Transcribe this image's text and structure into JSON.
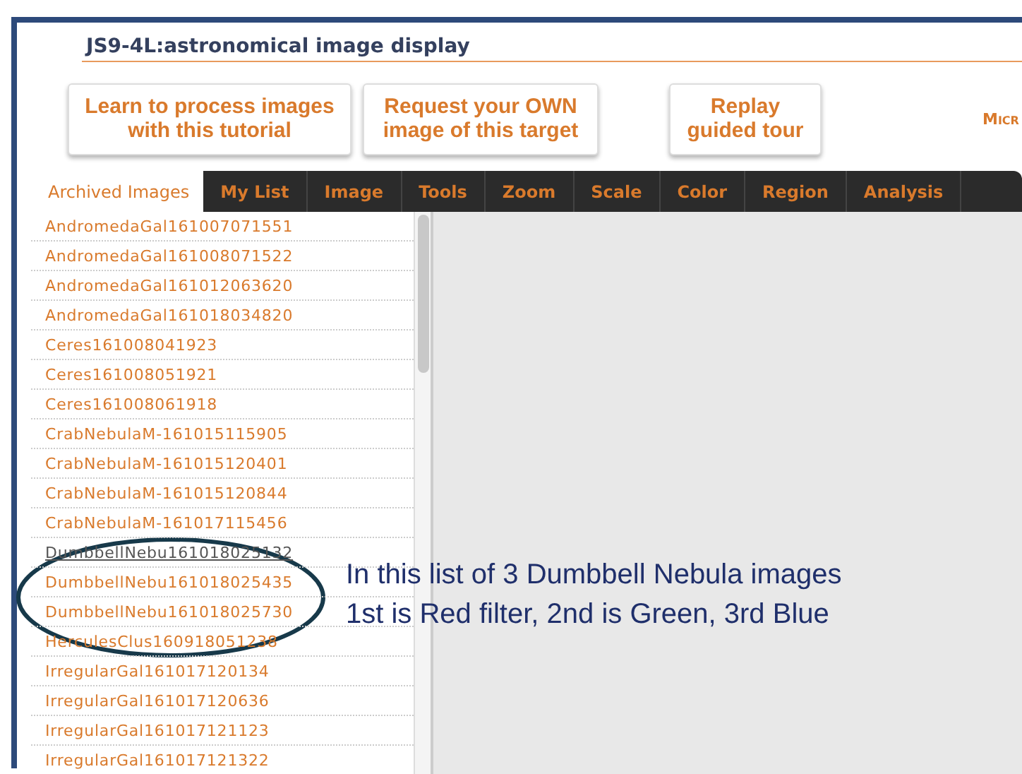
{
  "title": "JS9-4L:astronomical image display",
  "buttons": [
    {
      "label": "Learn to process images with this tutorial"
    },
    {
      "label": "Request your OWN image of this target"
    },
    {
      "label": "Replay guided tour"
    }
  ],
  "corner_text": "Micr",
  "tabs": [
    {
      "label": "Archived Images",
      "selected": true
    },
    {
      "label": "My List",
      "selected": false
    },
    {
      "label": "Image",
      "selected": false
    },
    {
      "label": "Tools",
      "selected": false
    },
    {
      "label": "Zoom",
      "selected": false
    },
    {
      "label": "Scale",
      "selected": false
    },
    {
      "label": "Color",
      "selected": false
    },
    {
      "label": "Region",
      "selected": false
    },
    {
      "label": "Analysis",
      "selected": false
    }
  ],
  "images": [
    {
      "name": "AndromedaGal161007071551",
      "highlighted": false
    },
    {
      "name": "AndromedaGal161008071522",
      "highlighted": false
    },
    {
      "name": "AndromedaGal161012063620",
      "highlighted": false
    },
    {
      "name": "AndromedaGal161018034820",
      "highlighted": false
    },
    {
      "name": "Ceres161008041923",
      "highlighted": false
    },
    {
      "name": "Ceres161008051921",
      "highlighted": false
    },
    {
      "name": "Ceres161008061918",
      "highlighted": false
    },
    {
      "name": "CrabNebulaM-161015115905",
      "highlighted": false
    },
    {
      "name": "CrabNebulaM-161015120401",
      "highlighted": false
    },
    {
      "name": "CrabNebulaM-161015120844",
      "highlighted": false
    },
    {
      "name": "CrabNebulaM-161017115456",
      "highlighted": false
    },
    {
      "name": "DumbbellNebu161018025132",
      "highlighted": true
    },
    {
      "name": "DumbbellNebu161018025435",
      "highlighted": false
    },
    {
      "name": "DumbbellNebu161018025730",
      "highlighted": false
    },
    {
      "name": "HerculesClus160918051238",
      "highlighted": false
    },
    {
      "name": "IrregularGal161017120134",
      "highlighted": false
    },
    {
      "name": "IrregularGal161017120636",
      "highlighted": false
    },
    {
      "name": "IrregularGal161017121123",
      "highlighted": false
    },
    {
      "name": "IrregularGal161017121322",
      "highlighted": false
    }
  ],
  "annotation": {
    "lines": [
      "In this list of 3 Dumbbell Nebula images",
      "1st is Red filter, 2nd is Green, 3rd Blue"
    ]
  }
}
